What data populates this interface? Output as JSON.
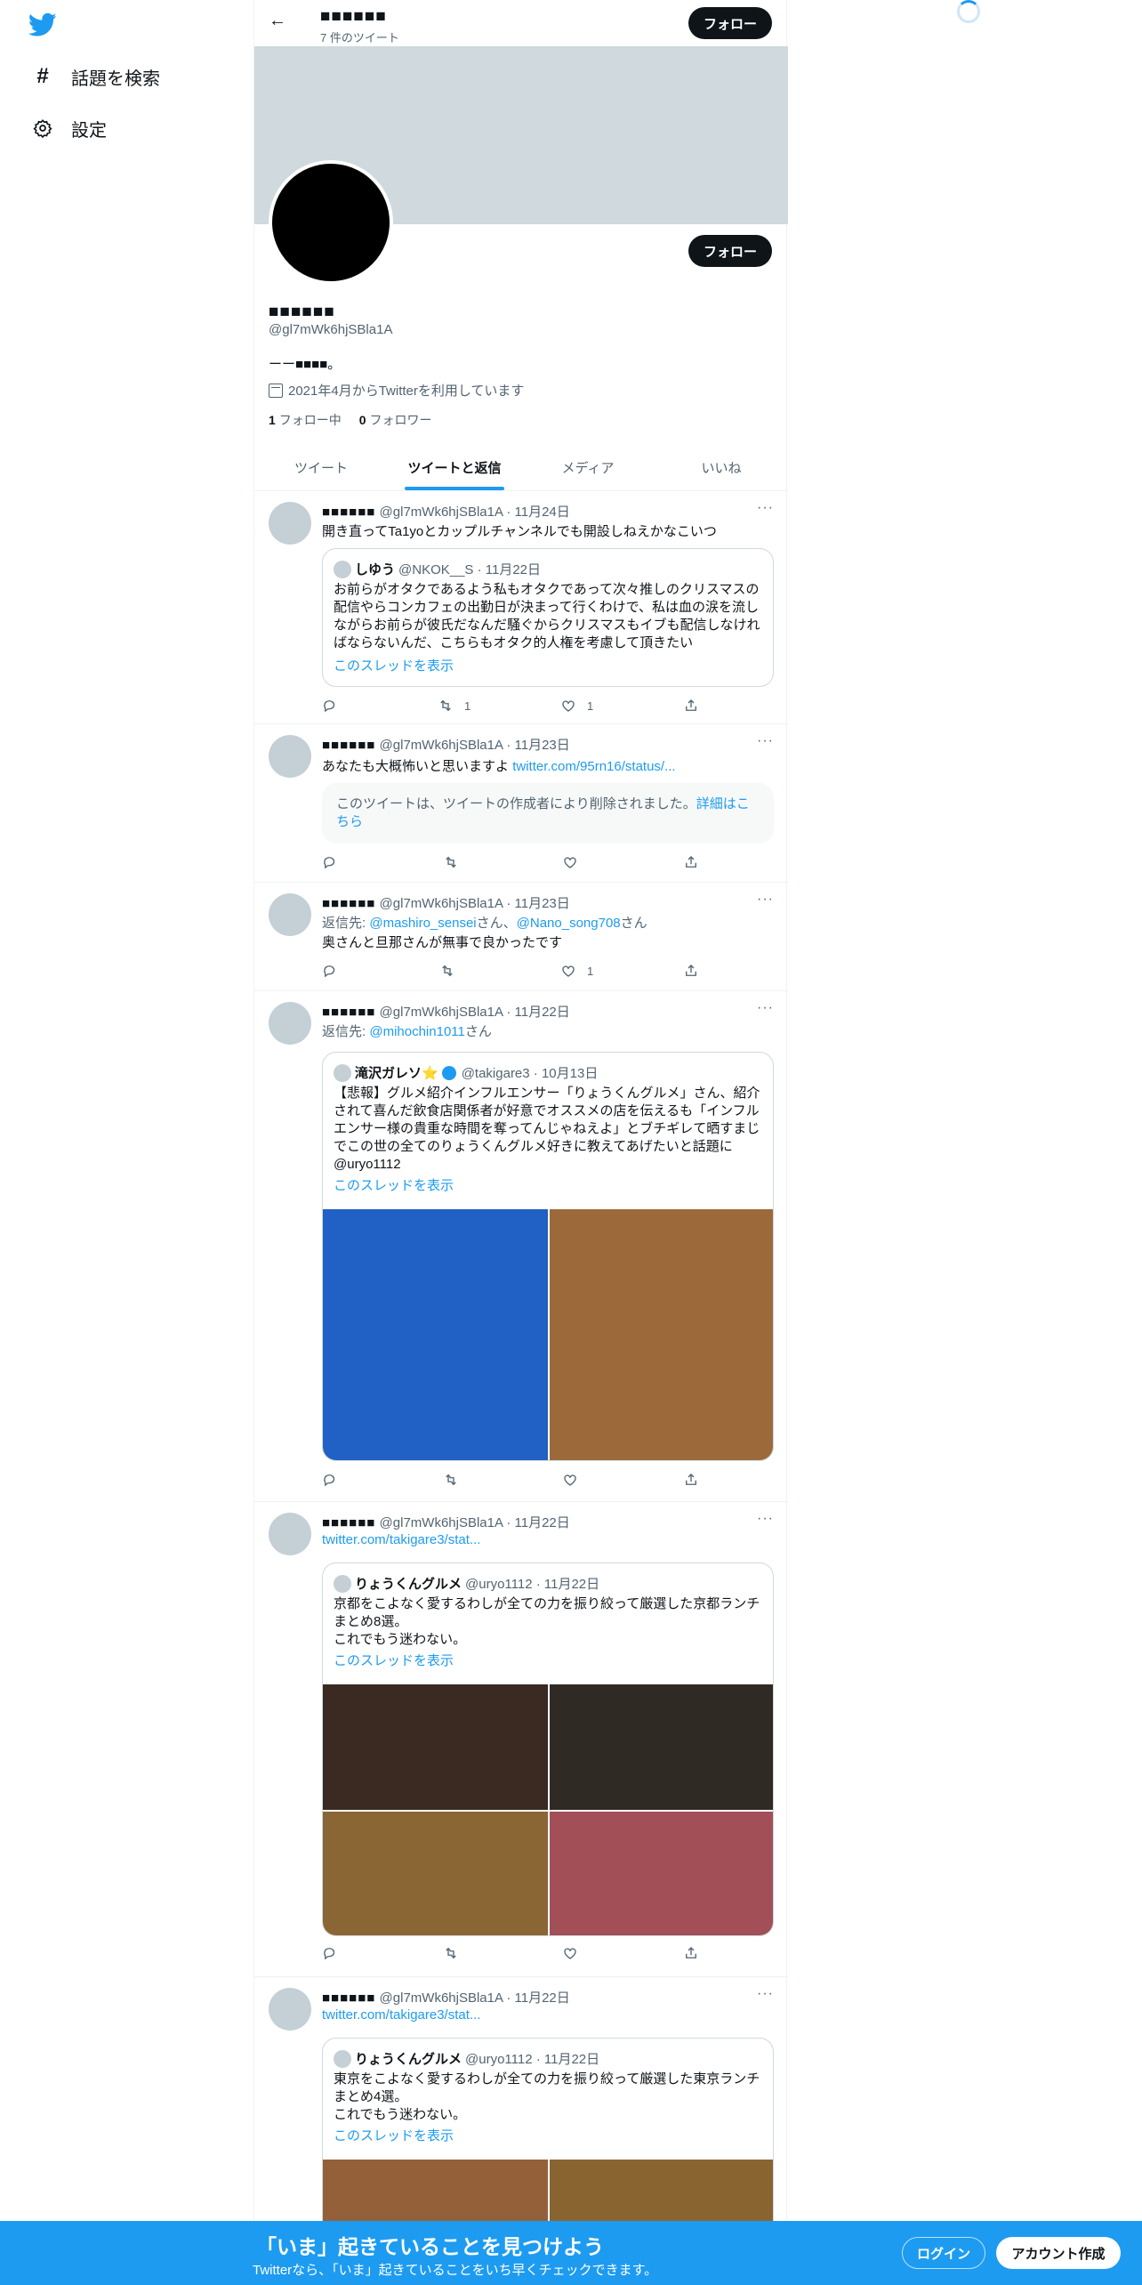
{
  "nav": {
    "explore": "話題を検索",
    "settings": "設定"
  },
  "header": {
    "name": "■■■■■■",
    "count": "7 件のツイート",
    "follow": "フォロー"
  },
  "profile": {
    "name": "■■■■■■",
    "handle": "@gl7mWk6hjSBla1A",
    "bio": "ーー■■■■。",
    "joined": "2021年4月からTwitterを利用しています",
    "following_count": "1",
    "following_label": "フォロー中",
    "followers_count": "0",
    "followers_label": "フォロワー",
    "follow": "フォロー"
  },
  "tabs": [
    "ツイート",
    "ツイートと返信",
    "メディア",
    "いいね"
  ],
  "tweets": [
    {
      "name": "■■■■■■",
      "meta": "@gl7mWk6hjSBla1A · 11月24日",
      "text": "開き直ってTa1yoとカップルチャンネルでも開設しねえかなこいつ",
      "quote": {
        "name": "しゆう",
        "meta": "@NKOK__S · 11月22日",
        "text": "お前らがオタクであるよう私もオタクであって次々推しのクリスマスの配信やらコンカフェの出勤日が決まって行くわけで、私は血の涙を流しながらお前らが彼氏だなんだ騒ぐからクリスマスもイブも配信しなければならないんだ、こちらもオタク的人権を考慮して頂きたい",
        "thread": "このスレッドを表示"
      },
      "retweets": "1",
      "likes": "1"
    },
    {
      "name": "■■■■■■",
      "meta": "@gl7mWk6hjSBla1A · 11月23日",
      "text": "あなたも大概怖いと思いますよ",
      "link": "twitter.com/95rn16/status/...",
      "deleted": "このツイートは、ツイートの作成者により削除されました。",
      "deleted_link": "詳細はこちら"
    },
    {
      "name": "■■■■■■",
      "meta": "@gl7mWk6hjSBla1A · 11月23日",
      "reply_label": "返信先: ",
      "reply_a": "@mashiro_sensei",
      "reply_mid": "さん、",
      "reply_b": "@Nano_song708",
      "reply_end": "さん",
      "text": "奥さんと旦那さんが無事で良かったです",
      "likes": "1"
    },
    {
      "name": "■■■■■■",
      "meta": "@gl7mWk6hjSBla1A · 11月22日",
      "reply_label": "返信先: ",
      "reply_a": "@mihochin1011",
      "reply_end": "さん",
      "quote": {
        "name": "滝沢ガレソ⭐",
        "meta": "@takigare3 · 10月13日",
        "text": "【悲報】グルメ紹介インフルエンサー「りょうくんグルメ」さん、紹介されて喜んだ飲食店関係者が好意でオススメの店を伝えるも「インフルエンサー様の貴重な時間を奪ってんじゃねえよ」とブチギレて晒すまじでこの世の全てのりょうくんグルメ好きに教えてあげたいと話題に @uryo1112",
        "thread": "このスレッドを表示",
        "images": [
          "#2160c4",
          "#9c6a3a"
        ]
      }
    },
    {
      "name": "■■■■■■",
      "meta": "@gl7mWk6hjSBla1A · 11月22日",
      "link": "twitter.com/takigare3/stat...",
      "quote": {
        "name": "りょうくんグルメ",
        "meta": "@uryo1112 · 11月22日",
        "text": "京都をこよなく愛するわしが全ての力を振り絞って厳選した京都ランチまとめ8選。\nこれでもう迷わない。",
        "thread": "このスレッドを表示",
        "images": [
          "#3a2a22",
          "#302a25",
          "#8a6634",
          "#a24f58"
        ]
      }
    },
    {
      "name": "■■■■■■",
      "meta": "@gl7mWk6hjSBla1A · 11月22日",
      "link": "twitter.com/takigare3/stat...",
      "quote": {
        "name": "りょうくんグルメ",
        "meta": "@uryo1112 · 11月22日",
        "text": "東京をこよなく愛するわしが全ての力を振り絞って厳選した東京ランチまとめ4選。\nこれでもう迷わない。",
        "thread": "このスレッドを表示",
        "images": [
          "#94603a",
          "#8a6430"
        ]
      }
    }
  ],
  "bottom": {
    "title": "「いま」起きていることを見つけよう",
    "subtitle": "Twitterなら、「いま」起きていることをいち早くチェックできます。",
    "login": "ログイン",
    "signup": "アカウント作成"
  },
  "colors": {
    "accent": "#1d9bf0",
    "banner": "#cfd9de"
  }
}
